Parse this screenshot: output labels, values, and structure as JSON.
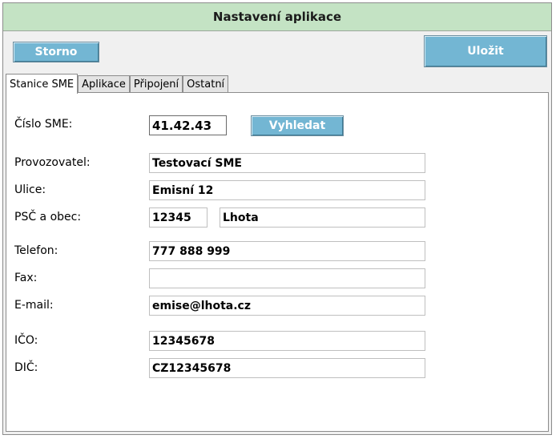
{
  "window": {
    "title": "Nastavení aplikace"
  },
  "toolbar": {
    "cancel_label": "Storno",
    "save_label": "Uložit"
  },
  "tabs": [
    {
      "label": "Stanice SME",
      "active": true
    },
    {
      "label": "Aplikace",
      "active": false
    },
    {
      "label": "Připojení",
      "active": false
    },
    {
      "label": "Ostatní",
      "active": false
    }
  ],
  "form": {
    "sme_number": {
      "label": "Číslo SME:",
      "value": "41.42.43"
    },
    "search_label": "Vyhledat",
    "operator": {
      "label": "Provozovatel:",
      "value": "Testovací SME"
    },
    "street": {
      "label": "Ulice:",
      "value": "Emisní 12"
    },
    "zip_city": {
      "label": "PSČ a obec:",
      "zip": "12345",
      "city": "Lhota"
    },
    "phone": {
      "label": "Telefon:",
      "value": "777 888 999"
    },
    "fax": {
      "label": "Fax:",
      "value": ""
    },
    "email": {
      "label": "E-mail:",
      "value": "emise@lhota.cz"
    },
    "ico": {
      "label": "IČO:",
      "value": "12345678"
    },
    "dic": {
      "label": "DIČ:",
      "value": "CZ12345678"
    }
  },
  "colors": {
    "title_bar": "#c4e3c4",
    "button": "#73b6d3",
    "background": "#f0f0f0"
  }
}
